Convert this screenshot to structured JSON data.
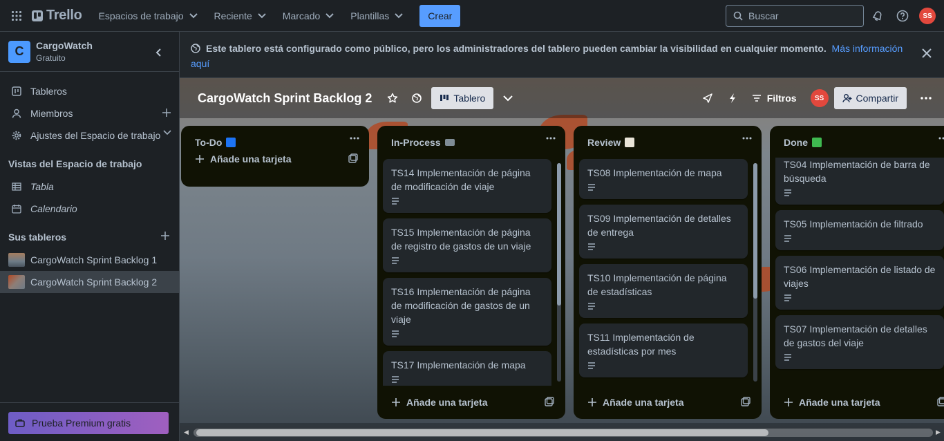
{
  "topbar": {
    "logo": "Trello",
    "nav": [
      {
        "label": "Espacios de trabajo"
      },
      {
        "label": "Reciente"
      },
      {
        "label": "Marcado"
      },
      {
        "label": "Plantillas"
      }
    ],
    "create_label": "Crear",
    "search_placeholder": "Buscar",
    "avatar_initials": "SS"
  },
  "sidebar": {
    "workspace_initial": "C",
    "workspace_name": "CargoWatch",
    "workspace_plan": "Gratuito",
    "items": [
      {
        "label": "Tableros",
        "icon": "board-icon"
      },
      {
        "label": "Miembros",
        "icon": "person-icon"
      },
      {
        "label": "Ajustes del Espacio de trabajo",
        "icon": "gear-icon"
      }
    ],
    "views_heading": "Vistas del Espacio de trabajo",
    "views": [
      {
        "label": "Tabla",
        "icon": "table-icon"
      },
      {
        "label": "Calendario",
        "icon": "calendar-icon"
      }
    ],
    "boards_heading": "Sus tableros",
    "boards": [
      {
        "label": "CargoWatch Sprint Backlog 1"
      },
      {
        "label": "CargoWatch Sprint Backlog 2"
      }
    ],
    "premium_label": "Prueba Premium gratis"
  },
  "notice": {
    "text": "Este tablero está configurado como público, pero los administradores del tablero pueden cambiar la visibilidad en cualquier momento.",
    "link": "Más información aquí"
  },
  "board": {
    "title": "CargoWatch Sprint Backlog 2",
    "view_label": "Tablero",
    "filters_label": "Filtros",
    "share_label": "Compartir",
    "avatar_initials": "SS"
  },
  "lists": [
    {
      "title": "To-Do",
      "emoji": "soon-arrow",
      "cards": [],
      "add_label": "Añade una tarjeta"
    },
    {
      "title": "In-Process",
      "emoji": "laptop",
      "add_label": "Añade una tarjeta",
      "cards": [
        {
          "title": "TS14 Implementación de página de modificación de viaje"
        },
        {
          "title": "TS15 Implementación de página de registro de gastos de un viaje"
        },
        {
          "title": "TS16 Implementación de página de modificación de gastos de un viaje"
        },
        {
          "title": "TS17 Implementación de mapa"
        }
      ]
    },
    {
      "title": "Review",
      "emoji": "memo",
      "add_label": "Añade una tarjeta",
      "cards": [
        {
          "title": "TS08 Implementación de mapa"
        },
        {
          "title": "TS09 Implementación de detalles de entrega"
        },
        {
          "title": "TS10 Implementación de página de estadísticas"
        },
        {
          "title": "TS11 Implementación de estadísticas por mes"
        }
      ]
    },
    {
      "title": "Done",
      "emoji": "check-mark",
      "add_label": "Añade una tarjeta",
      "cards": [
        {
          "title": "TS04 Implementación de barra de búsqueda"
        },
        {
          "title": "TS05 Implementación de filtrado"
        },
        {
          "title": "TS06 Implementación de listado de viajes"
        },
        {
          "title": "TS07 Implementación de detalles de gastos del viaje"
        }
      ]
    }
  ]
}
